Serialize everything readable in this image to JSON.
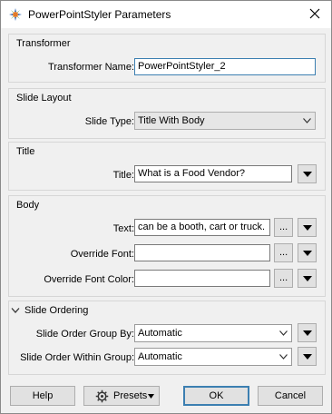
{
  "window": {
    "title": "PowerPointStyler Parameters"
  },
  "icons": {
    "app": "styler-app-icon",
    "close": "close-icon",
    "ellipsis": "ellipsis-icon",
    "menu": "triangle-down-icon",
    "chevron": "chevron-down-icon",
    "gear": "gear-icon"
  },
  "transformer": {
    "group_label": "Transformer",
    "name_label": "Transformer Name:",
    "name_value": "PowerPointStyler_2"
  },
  "slide_layout": {
    "group_label": "Slide Layout",
    "type_label": "Slide Type:",
    "type_value": "Title With Body"
  },
  "title_section": {
    "group_label": "Title",
    "title_label": "Title:",
    "title_value": "What is a Food Vendor?"
  },
  "body": {
    "group_label": "Body",
    "text_label": "Text:",
    "text_value": "can be a booth, cart or truck.",
    "font_label": "Override Font:",
    "font_value": "",
    "color_label": "Override Font Color:",
    "color_value": "",
    "ellipsis": "..."
  },
  "slide_ordering": {
    "group_label": "Slide Ordering",
    "group_by_label": "Slide Order Group By:",
    "group_by_value": "Automatic",
    "within_label": "Slide Order Within Group:",
    "within_value": "Automatic"
  },
  "buttons": {
    "help": "Help",
    "presets": "Presets",
    "ok": "OK",
    "cancel": "Cancel"
  },
  "colors": {
    "accent": "#3c7fb1",
    "dialog_bg": "#f0f0f0"
  }
}
